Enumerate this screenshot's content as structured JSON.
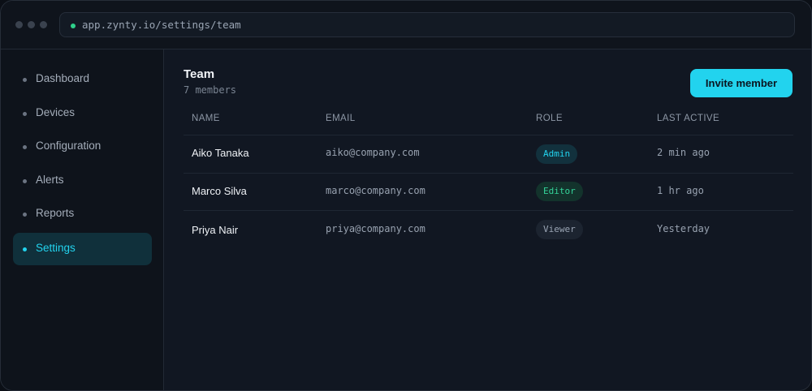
{
  "browser": {
    "url": "app.zynty.io/settings/team"
  },
  "sidebar": {
    "items": [
      {
        "label": "Dashboard",
        "active": false
      },
      {
        "label": "Devices",
        "active": false
      },
      {
        "label": "Configuration",
        "active": false
      },
      {
        "label": "Alerts",
        "active": false
      },
      {
        "label": "Reports",
        "active": false
      },
      {
        "label": "Settings",
        "active": true
      }
    ]
  },
  "main": {
    "title": "Team",
    "subtitle": "7 members",
    "invite_label": "Invite member",
    "table": {
      "columns": [
        "NAME",
        "EMAIL",
        "ROLE",
        "LAST ACTIVE"
      ],
      "rows": [
        {
          "name": "Aiko Tanaka",
          "email": "aiko@company.com",
          "role": "Admin",
          "last_active": "2 min ago"
        },
        {
          "name": "Marco Silva",
          "email": "marco@company.com",
          "role": "Editor",
          "last_active": "1 hr ago"
        },
        {
          "name": "Priya Nair",
          "email": "priya@company.com",
          "role": "Viewer",
          "last_active": "Yesterday"
        }
      ]
    }
  },
  "colors": {
    "accent": "#22d3ee",
    "status_online": "#2fd18b",
    "role_admin": "#22d3ee",
    "role_editor": "#34d399",
    "role_viewer": "#9aa5b4",
    "background": "#111722"
  }
}
